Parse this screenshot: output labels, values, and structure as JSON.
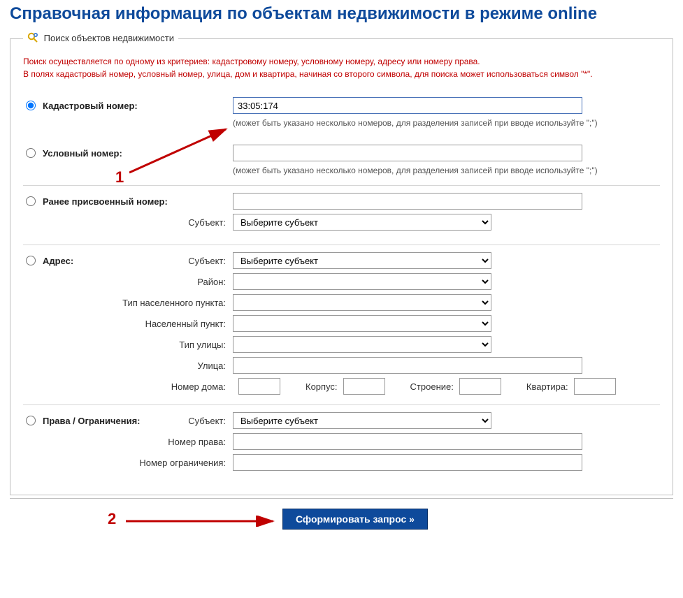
{
  "page": {
    "title": "Справочная информация по объектам недвижимости в режиме online"
  },
  "legend": "Поиск объектов недвижимости",
  "warn": {
    "line1": "Поиск осуществляется по одному из критериев: кадастровому номеру, условному номеру, адресу или номеру права.",
    "line2": "В полях кадастровый номер, условный номер, улица, дом и квартира, начиная со второго символа, для поиска может использоваться символ \"*\"."
  },
  "cad": {
    "label": "Кадастровый номер:",
    "value": "33:05:174",
    "hint": "(может быть указано несколько номеров, для разделения записей при вводе используйте \";\")"
  },
  "cond": {
    "label": "Условный номер:",
    "hint": "(может быть указано несколько номеров, для разделения записей при вводе используйте \";\")"
  },
  "prev": {
    "label": "Ранее присвоенный номер:",
    "subject_label": "Субъект:",
    "subject_placeholder": "Выберите субъект"
  },
  "addr": {
    "label": "Адрес:",
    "subject_label": "Субъект:",
    "subject_placeholder": "Выберите субъект",
    "district_label": "Район:",
    "settlement_type_label": "Тип населенного пункта:",
    "settlement_label": "Населенный пункт:",
    "street_type_label": "Тип улицы:",
    "street_label": "Улица:",
    "house_label": "Номер дома:",
    "korpus_label": "Корпус:",
    "building_label": "Строение:",
    "flat_label": "Квартира:"
  },
  "rights": {
    "label": "Права / Ограничения:",
    "subject_label": "Субъект:",
    "subject_placeholder": "Выберите субъект",
    "right_no_label": "Номер права:",
    "limit_no_label": "Номер ограничения:"
  },
  "submit": {
    "label": "Сформировать запрос »"
  },
  "anno": {
    "one": "1",
    "two": "2"
  }
}
